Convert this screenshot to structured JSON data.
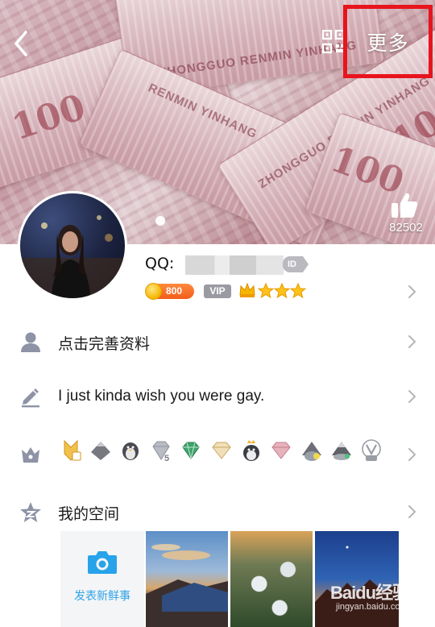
{
  "header": {
    "more_label": "更多",
    "like_count": "82502"
  },
  "profile": {
    "qq_label": "QQ:",
    "id_badge": "ID",
    "coin_value": "800",
    "vip_label": "VIP",
    "star_count": 3
  },
  "rows": {
    "complete_profile": "点击完善资料",
    "signature": "I just kinda wish you were gay.",
    "my_space": "我的空间"
  },
  "space": {
    "publish_label": "发表新鲜事"
  },
  "watermark": {
    "brand": "Baidu经验",
    "url": "jingyan.baidu.com"
  },
  "colors": {
    "highlight_box": "#e8141d",
    "coin_badge": "#f25d1c",
    "link_blue": "#2ea3e6"
  }
}
